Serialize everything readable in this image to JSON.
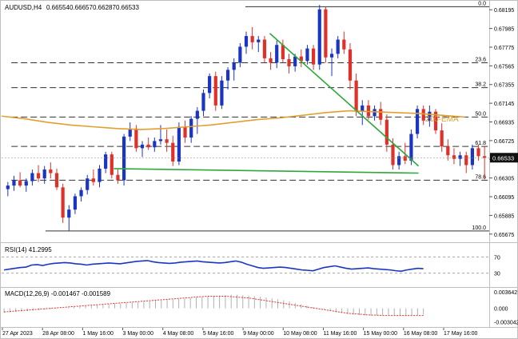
{
  "chart_data": {
    "type": "candlestick",
    "title": "AUDUSD,H4",
    "ohlc_header": [
      "0.66554",
      "0.66657",
      "0.66287",
      "0.66533"
    ],
    "price_axis": {
      "ticks": [
        "0.68195",
        "0.67985",
        "0.67775",
        "0.67565",
        "0.67355",
        "0.67145",
        "0.66935",
        "0.66725",
        "0.66515",
        "0.66305",
        "0.66095",
        "0.65885",
        "0.65675"
      ],
      "current_price": "0.66533",
      "range": [
        0.6561,
        0.6826
      ]
    },
    "time_axis": [
      "27 Apr 2023",
      "28 Apr 08:00",
      "1 May 16:00",
      "3 May 00:00",
      "4 May 08:00",
      "5 May 16:00",
      "9 May 00:00",
      "10 May 08:00",
      "11 May 16:00",
      "15 May 00:00",
      "16 May 08:00",
      "17 May 16:00"
    ],
    "fibonacci": [
      {
        "label": "0.0",
        "price": 0.6823
      },
      {
        "label": "23.6",
        "price": 0.676
      },
      {
        "label": "38.2",
        "price": 0.6732
      },
      {
        "label": "50.0",
        "price": 0.6699
      },
      {
        "label": "61.8",
        "price": 0.6666
      },
      {
        "label": "78.6",
        "price": 0.6628
      },
      {
        "label": "100.0",
        "price": 0.6571
      }
    ],
    "ema_label": "200-EMA",
    "ema": [
      0.67,
      0.6697,
      0.6693,
      0.669,
      0.6688,
      0.6686,
      0.6685,
      0.6686,
      0.6688,
      0.669,
      0.6693,
      0.6696,
      0.6698,
      0.6701,
      0.6704,
      0.6706,
      0.6705,
      0.6704,
      0.6703,
      0.6701,
      0.6699
    ],
    "trendlines": [
      {
        "from": [
          0.55,
          0.6793
        ],
        "to": [
          0.855,
          0.6644
        ]
      },
      {
        "from": [
          0.23,
          0.6641
        ],
        "to": [
          0.855,
          0.6636
        ]
      }
    ],
    "candles": [
      [
        0.6618,
        0.6626,
        0.661,
        0.6622
      ],
      [
        0.6622,
        0.6633,
        0.6616,
        0.6628
      ],
      [
        0.6628,
        0.6637,
        0.662,
        0.6622
      ],
      [
        0.6622,
        0.663,
        0.6615,
        0.6627
      ],
      [
        0.6627,
        0.664,
        0.6622,
        0.6636
      ],
      [
        0.6636,
        0.6645,
        0.6626,
        0.663
      ],
      [
        0.663,
        0.6644,
        0.6624,
        0.664
      ],
      [
        0.664,
        0.6648,
        0.663,
        0.6636
      ],
      [
        0.6636,
        0.6641,
        0.6617,
        0.662
      ],
      [
        0.662,
        0.6624,
        0.658,
        0.6586
      ],
      [
        0.6586,
        0.66,
        0.6571,
        0.6595
      ],
      [
        0.6595,
        0.6613,
        0.659,
        0.661
      ],
      [
        0.661,
        0.662,
        0.6604,
        0.6617
      ],
      [
        0.6617,
        0.6634,
        0.6612,
        0.663
      ],
      [
        0.663,
        0.664,
        0.6622,
        0.6626
      ],
      [
        0.6626,
        0.6645,
        0.662,
        0.6641
      ],
      [
        0.6641,
        0.666,
        0.6636,
        0.6657
      ],
      [
        0.6657,
        0.666,
        0.663,
        0.6634
      ],
      [
        0.6634,
        0.664,
        0.6624,
        0.6628
      ],
      [
        0.6628,
        0.668,
        0.6622,
        0.6677
      ],
      [
        0.6677,
        0.6693,
        0.6672,
        0.6686
      ],
      [
        0.6686,
        0.669,
        0.666,
        0.6664
      ],
      [
        0.6664,
        0.6672,
        0.6654,
        0.6668
      ],
      [
        0.6668,
        0.6676,
        0.6662,
        0.6665
      ],
      [
        0.6665,
        0.6676,
        0.666,
        0.6672
      ],
      [
        0.6672,
        0.669,
        0.6668,
        0.6674
      ],
      [
        0.6674,
        0.6685,
        0.666,
        0.667
      ],
      [
        0.667,
        0.6678,
        0.6644,
        0.6649
      ],
      [
        0.6649,
        0.6693,
        0.6645,
        0.6688
      ],
      [
        0.6688,
        0.6695,
        0.667,
        0.6676
      ],
      [
        0.6676,
        0.67,
        0.667,
        0.6697
      ],
      [
        0.6697,
        0.671,
        0.668,
        0.6706
      ],
      [
        0.6706,
        0.673,
        0.67,
        0.6726
      ],
      [
        0.6726,
        0.6748,
        0.672,
        0.6745
      ],
      [
        0.6745,
        0.675,
        0.6706,
        0.6712
      ],
      [
        0.6712,
        0.6745,
        0.6708,
        0.674
      ],
      [
        0.674,
        0.6755,
        0.673,
        0.6752
      ],
      [
        0.6752,
        0.6765,
        0.674,
        0.676
      ],
      [
        0.676,
        0.6782,
        0.6755,
        0.6778
      ],
      [
        0.6778,
        0.6795,
        0.677,
        0.679
      ],
      [
        0.679,
        0.68,
        0.6775,
        0.6783
      ],
      [
        0.6783,
        0.679,
        0.6772,
        0.6786
      ],
      [
        0.6786,
        0.679,
        0.676,
        0.6765
      ],
      [
        0.6765,
        0.6772,
        0.6752,
        0.676
      ],
      [
        0.676,
        0.6785,
        0.6754,
        0.678
      ],
      [
        0.678,
        0.6786,
        0.676,
        0.6764
      ],
      [
        0.6764,
        0.677,
        0.6748,
        0.6756
      ],
      [
        0.6756,
        0.677,
        0.675,
        0.6767
      ],
      [
        0.6767,
        0.6775,
        0.6755,
        0.6762
      ],
      [
        0.6762,
        0.678,
        0.6758,
        0.6776
      ],
      [
        0.6776,
        0.678,
        0.6752,
        0.6758
      ],
      [
        0.6758,
        0.6825,
        0.6752,
        0.682
      ],
      [
        0.682,
        0.6823,
        0.676,
        0.6766
      ],
      [
        0.6766,
        0.6776,
        0.6745,
        0.677
      ],
      [
        0.677,
        0.679,
        0.6765,
        0.6786
      ],
      [
        0.6786,
        0.6795,
        0.677,
        0.6775
      ],
      [
        0.6775,
        0.6782,
        0.673,
        0.674
      ],
      [
        0.674,
        0.6748,
        0.67,
        0.6705
      ],
      [
        0.6705,
        0.6718,
        0.669,
        0.6712
      ],
      [
        0.6712,
        0.6718,
        0.6696,
        0.67
      ],
      [
        0.67,
        0.6712,
        0.6695,
        0.6708
      ],
      [
        0.6708,
        0.6716,
        0.669,
        0.6696
      ],
      [
        0.6696,
        0.6702,
        0.666,
        0.6668
      ],
      [
        0.6668,
        0.6675,
        0.664,
        0.6645
      ],
      [
        0.6645,
        0.666,
        0.664,
        0.6655
      ],
      [
        0.6655,
        0.667,
        0.6646,
        0.665
      ],
      [
        0.665,
        0.6685,
        0.6645,
        0.668
      ],
      [
        0.668,
        0.6712,
        0.6675,
        0.6708
      ],
      [
        0.6708,
        0.6712,
        0.669,
        0.6695
      ],
      [
        0.6695,
        0.6712,
        0.6688,
        0.6705
      ],
      [
        0.6705,
        0.6708,
        0.668,
        0.6684
      ],
      [
        0.6684,
        0.6692,
        0.666,
        0.6666
      ],
      [
        0.6666,
        0.6674,
        0.665,
        0.6656
      ],
      [
        0.6656,
        0.6664,
        0.6646,
        0.6652
      ],
      [
        0.6652,
        0.666,
        0.6644,
        0.6656
      ],
      [
        0.6656,
        0.666,
        0.6636,
        0.6645
      ],
      [
        0.6645,
        0.6668,
        0.664,
        0.6664
      ],
      [
        0.6664,
        0.6668,
        0.665,
        0.6655
      ],
      [
        0.6655,
        0.6666,
        0.6629,
        0.6653
      ]
    ],
    "rsi": {
      "label": "RSI(14) 41.2995",
      "levels": [
        70,
        30
      ],
      "ticks": [
        "70",
        "30"
      ],
      "range": [
        0,
        100
      ],
      "values": [
        38,
        40,
        42,
        44,
        45,
        50,
        51,
        49,
        52,
        54,
        55,
        56,
        55,
        53,
        52,
        50,
        52,
        53,
        54,
        55,
        54,
        53,
        55,
        57,
        59,
        60,
        61,
        58,
        56,
        55,
        54,
        55,
        57,
        58,
        59,
        60,
        58,
        57,
        56,
        55,
        56,
        58,
        60,
        57,
        52,
        48,
        44,
        42,
        43,
        44,
        45,
        44,
        42,
        40,
        38,
        37,
        36,
        40,
        44,
        46,
        48,
        45,
        42,
        40,
        41,
        42,
        43,
        41,
        40,
        39,
        38,
        36,
        35,
        38,
        40,
        42,
        41
      ]
    },
    "macd": {
      "label": "MACD(12,26,9) -0.001467 -0.001589",
      "ticks": [
        "0.003642",
        "0.000",
        "-0.003042"
      ],
      "range": [
        -0.0038,
        0.0042
      ],
      "histogram": [
        -0.001,
        -0.0009,
        -0.0008,
        -0.0007,
        -0.0006,
        -0.0005,
        -0.0004,
        -0.0003,
        -0.0002,
        -0.0001,
        0.0,
        0.0002,
        0.0003,
        0.0004,
        0.0005,
        0.0006,
        0.0007,
        0.0008,
        0.0009,
        0.001,
        0.0011,
        0.0012,
        0.0013,
        0.0014,
        0.0015,
        0.0016,
        0.0017,
        0.0018,
        0.0019,
        0.002,
        0.0021,
        0.0022,
        0.0023,
        0.0024,
        0.0025,
        0.0026,
        0.0027,
        0.0028,
        0.0029,
        0.003,
        0.003,
        0.0029,
        0.0028,
        0.0027,
        0.0026,
        0.0024,
        0.0022,
        0.002,
        0.0018,
        0.0015,
        0.0012,
        0.0009,
        0.0006,
        0.0003,
        0.0,
        -0.0003,
        -0.0006,
        -0.0009,
        -0.0011,
        -0.0013,
        -0.0014,
        -0.0015,
        -0.0016,
        -0.0016,
        -0.0016,
        -0.0015,
        -0.0015,
        -0.0015,
        -0.0016,
        -0.0016,
        -0.0015,
        -0.0015,
        -0.0014
      ],
      "signal": [
        -0.0008,
        -0.0007,
        -0.0006,
        -0.0005,
        -0.0004,
        -0.0003,
        -0.0002,
        -0.0001,
        0.0,
        0.0001,
        0.0002,
        0.0003,
        0.0004,
        0.0005,
        0.0006,
        0.0007,
        0.0008,
        0.0009,
        0.001,
        0.0011,
        0.0012,
        0.0013,
        0.0014,
        0.0015,
        0.0016,
        0.0017,
        0.0018,
        0.0019,
        0.002,
        0.0021,
        0.0022,
        0.0023,
        0.0024,
        0.0025,
        0.0026,
        0.0027,
        0.0027,
        0.0027,
        0.0027,
        0.0026,
        0.0025,
        0.0024,
        0.0023,
        0.0021,
        0.0019,
        0.0017,
        0.0015,
        0.0013,
        0.0011,
        0.0009,
        0.0007,
        0.0005,
        0.0003,
        0.0001,
        -0.0001,
        -0.0003,
        -0.0005,
        -0.0007,
        -0.0009,
        -0.0011,
        -0.0012,
        -0.0013,
        -0.0014,
        -0.0015,
        -0.0015,
        -0.0016,
        -0.0016,
        -0.0016,
        -0.0016,
        -0.0016,
        -0.0016,
        -0.0016,
        -0.0016
      ]
    },
    "colors": {
      "bull": "#1a35c2",
      "bear": "#e0302a",
      "ema": "#e0a030",
      "trend": "#2ea83a",
      "fib": "#333333",
      "rsi": "#1a35c2",
      "macd_hist": "#b0b0b0",
      "macd_signal": "#e0302a",
      "price_tag": "#111111"
    }
  }
}
